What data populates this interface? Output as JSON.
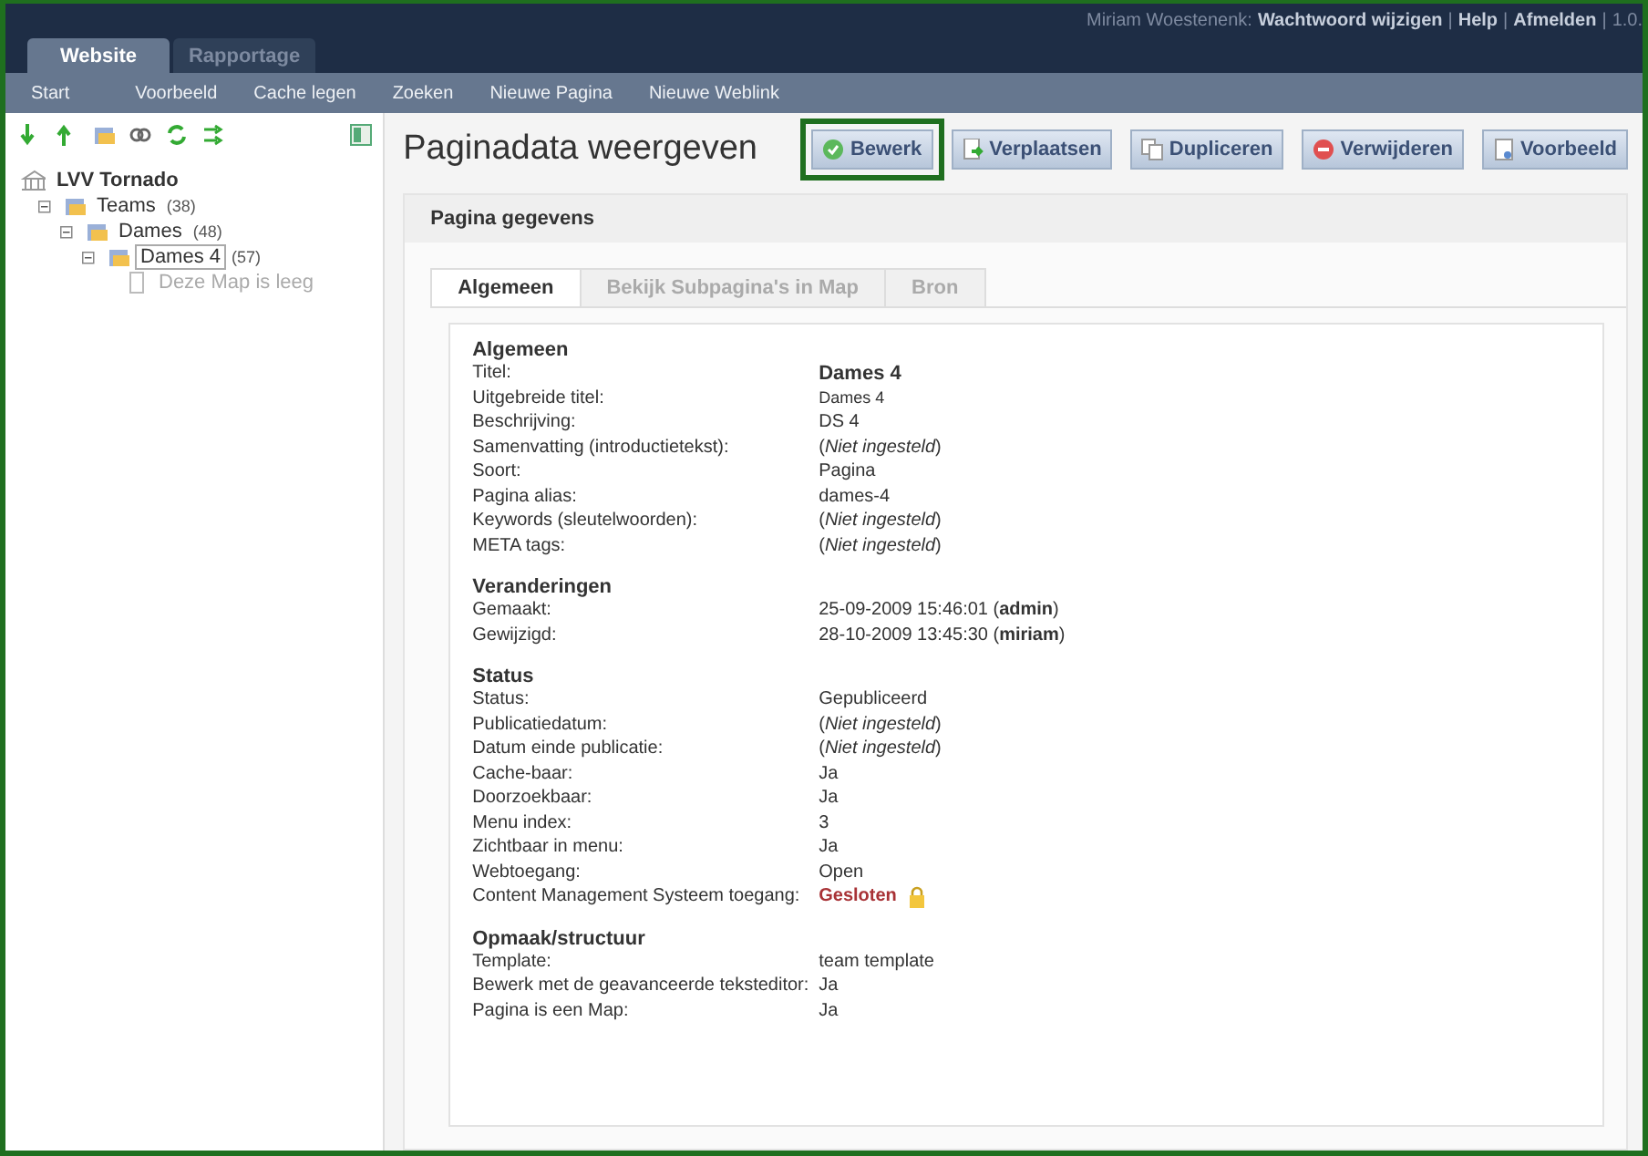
{
  "top_tabs": [
    {
      "label": "Website",
      "selected": true
    },
    {
      "label": "Rapportage",
      "selected": false
    }
  ],
  "user_bar": {
    "user": "Miriam Woestenenk:",
    "links": [
      "Wachtwoord wijzigen",
      "Help",
      "Afmelden"
    ],
    "separator": "|",
    "version": "1.0."
  },
  "nav": [
    "Start",
    "Voorbeeld",
    "Cache legen",
    "Zoeken",
    "Nieuwe Pagina",
    "Nieuwe Weblink"
  ],
  "tree": {
    "root": "LVV Tornado",
    "children": [
      {
        "label": "Teams",
        "count": "(38)",
        "selected": false,
        "children": [
          {
            "label": "Dames",
            "count": "(48)",
            "selected": false,
            "children": [
              {
                "label": "Dames 4",
                "count": "(57)",
                "selected": true,
                "empty_note": "Deze Map is leeg"
              }
            ]
          }
        ]
      }
    ]
  },
  "page_title": "Paginadata weergeven",
  "actions": [
    {
      "label": "Bewerk",
      "kind": "edit",
      "highlighted": true
    },
    {
      "label": "Verplaatsen",
      "kind": "move",
      "highlighted": false
    },
    {
      "label": "Dupliceren",
      "kind": "copy",
      "highlighted": false
    },
    {
      "label": "Verwijderen",
      "kind": "delete",
      "highlighted": false
    },
    {
      "label": "Voorbeeld",
      "kind": "preview",
      "highlighted": false
    }
  ],
  "panel_title": "Pagina gegevens",
  "tabs": [
    {
      "label": "Algemeen",
      "selected": true
    },
    {
      "label": "Bekijk Subpagina's in Map",
      "selected": false
    },
    {
      "label": "Bron",
      "selected": false
    }
  ],
  "sections": [
    {
      "title": "Algemeen",
      "rows": [
        {
          "label": "Titel:",
          "value": "Dames 4",
          "kind": "bold"
        },
        {
          "label": "Uitgebreide titel:",
          "value": "Dames 4",
          "kind": "small"
        },
        {
          "label": "Beschrijving:",
          "value": "DS 4",
          "kind": "plain"
        },
        {
          "label": "Samenvatting (introductietekst):",
          "value": "(*Niet ingesteld*)",
          "kind": "plain"
        },
        {
          "label": "Soort:",
          "value": "Pagina",
          "kind": "plain"
        },
        {
          "label": "Pagina alias:",
          "value": "dames-4",
          "kind": "plain"
        },
        {
          "label": "Keywords (sleutelwoorden):",
          "value": "(*Niet ingesteld*)",
          "kind": "plain"
        },
        {
          "label": "META tags:",
          "value": "(*Niet ingesteld*)",
          "kind": "plain"
        }
      ]
    },
    {
      "title": "Veranderingen",
      "rows": [
        {
          "label": "Gemaakt:",
          "value": "25-09-2009 15:46:01 (**admin**)",
          "kind": "plain"
        },
        {
          "label": "Gewijzigd:",
          "value": "28-10-2009 13:45:30 (**miriam**)",
          "kind": "plain"
        }
      ]
    },
    {
      "title": "Status",
      "rows": [
        {
          "label": "Status:",
          "value": "Gepubliceerd",
          "kind": "plain"
        },
        {
          "label": "Publicatiedatum:",
          "value": "(*Niet ingesteld*)",
          "kind": "plain"
        },
        {
          "label": "Datum einde publicatie:",
          "value": "(*Niet ingesteld*)",
          "kind": "plain"
        },
        {
          "label": "Cache-baar:",
          "value": "Ja",
          "kind": "plain"
        },
        {
          "label": "Doorzoekbaar:",
          "value": "Ja",
          "kind": "plain"
        },
        {
          "label": "Menu index:",
          "value": "3",
          "kind": "plain"
        },
        {
          "label": "Zichtbaar in menu:",
          "value": "Ja",
          "kind": "plain"
        },
        {
          "label": "Webtoegang:",
          "value": "Open",
          "kind": "plain"
        },
        {
          "label": "Content Management Systeem toegang:",
          "value": "Gesloten",
          "kind": "locked"
        }
      ]
    },
    {
      "title": "Opmaak/structuur",
      "rows": [
        {
          "label": "Template:",
          "value": "team template",
          "kind": "plain"
        },
        {
          "label": "Bewerk met de geavanceerde teksteditor:",
          "value": "Ja",
          "kind": "plain"
        },
        {
          "label": "Pagina is een Map:",
          "value": "Ja",
          "kind": "plain"
        }
      ]
    }
  ]
}
